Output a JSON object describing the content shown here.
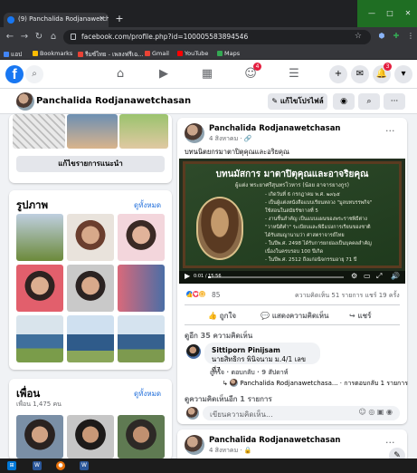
{
  "browser": {
    "tab_title": "(9) Panchalida Rodjanawetchasan",
    "url": "facebook.com/profile.php?id=100005583894546",
    "bookmarks": [
      "แอป",
      "Bookmarks",
      "รีมซ์ไทย - เพลงฟรีเฉ...",
      "Gmail",
      "YouTube",
      "Maps"
    ]
  },
  "fb_nav": {
    "logo": "f",
    "notification_badge": "4",
    "notification_badge2": "3"
  },
  "profile_bar": {
    "name": "Panchalida Rodjanawetchasan",
    "edit_profile": "แก้ไขโปรไฟล์"
  },
  "left": {
    "edit_featured": "แก้ไขรายการแนะนำ",
    "photos_title": "รูปภาพ",
    "see_all_photos": "ดูทั้งหมด",
    "friends_title": "เพื่อน",
    "friends_count": "เพื่อน 1,475 คน",
    "see_all_friends": "ดูทั้งหมด"
  },
  "post": {
    "author": "Panchalida Rodjanawetchasan",
    "date": "4 สิงหาคม · 🔗",
    "caption": "บทนนิตยกรมาตาปิตุคุณและอริยคุณ",
    "board_title": "บทนมัสการ มาตาปิตุคุณและอาจริยคุณ",
    "board_subtitle": "ผู้แต่ง พระยาศรีสุนทรโวหาร (น้อย อาจารยางกูร)",
    "board_lines": [
      "- เกิดวันที่ 6 กรกฎาคม พ.ศ. ๒๓๖๕",
      "- เป็นผู้แต่งหนังสือแบบเรียนหลวง \"มูลบทบรรพกิจ\"",
      "  ใช้สอนในสมัยรัชกาลที่ 5",
      "- งานชิ้นสำคัญ เป็นแบบแผนของพระราชพิธีต่าง",
      "  \"วาหนิติคำ\" ระเบียบและพิธีแบ่งการเรียนของชาติ",
      "  ได้รับสมญานามว่า ศาสตราจารย์ไทย",
      "- ในปีพ.ศ. 2498 ได้รับการยกย่องเป็นบุคคลสำคัญ",
      "  เนื่องในครบรอบ 100 ปีเกิด",
      "- ในปีพ.ศ. 2512 ถึงแก่อนิจกรรมอายุ 71 ปี"
    ],
    "video_time": "0:01 / 15:56",
    "video_progress": 0.02,
    "reaction_count": "85",
    "comments_shares": "ความคิดเห็น 51 รายการ  แชร์ 19 ครั้ง",
    "like": "ถูกใจ",
    "comment": "แสดงความคิดเห็น",
    "share": "แชร์",
    "view_comments": "ดูอีก 35 ความคิดเห็น",
    "comment1": {
      "name": "Sittiporn Pinijsam",
      "text": "นายสิทธิกร พินิจนาม ม.4/1 เลขที่7",
      "actions": "ถูกใจ · ตอบกลับ · 9 สัปดาห์",
      "reply": "Panchalida Rodjanawetchasa... · การตอบกลับ 1 รายการ"
    },
    "more_comments": "ดูความคิดเห็นอีก 1 รายการ",
    "write_comment": "เขียนความคิดเห็น..."
  },
  "post2": {
    "author": "Panchalida Rodjanawetchasan",
    "date": "4 สิงหาคม · 🔒"
  },
  "taskbar": [
    "⊞",
    "W",
    "●",
    "W"
  ]
}
